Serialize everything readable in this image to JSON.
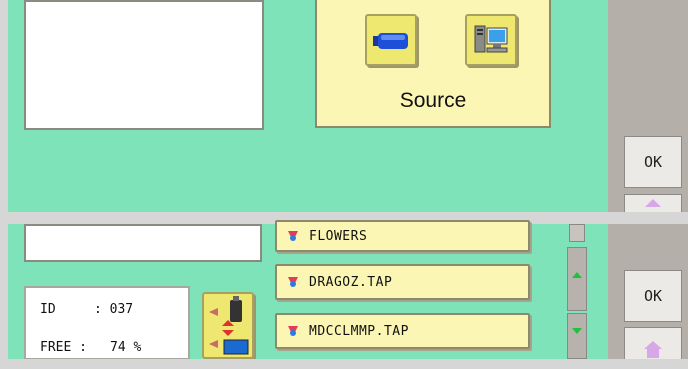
{
  "top": {
    "source_label": "Source",
    "ok_label": "OK",
    "icons": [
      "usb-drive-icon",
      "computer-icon",
      "home-icon"
    ]
  },
  "bottom": {
    "files": [
      {
        "name": "FLOWERS",
        "icon": "embroidery-file-icon"
      },
      {
        "name": "DRAGOZ.TAP",
        "icon": "embroidery-file-icon"
      },
      {
        "name": "MDCCLMMP.TAP",
        "icon": "embroidery-file-icon"
      }
    ],
    "info": {
      "id_label": "ID",
      "id_value": ": 037",
      "free_label": "FREE :",
      "free_value": "74 %"
    },
    "ok_label": "OK",
    "colors": {
      "panel": "#7ee3b8",
      "button": "#fcf6b4",
      "side": "#b4b0a9"
    }
  }
}
